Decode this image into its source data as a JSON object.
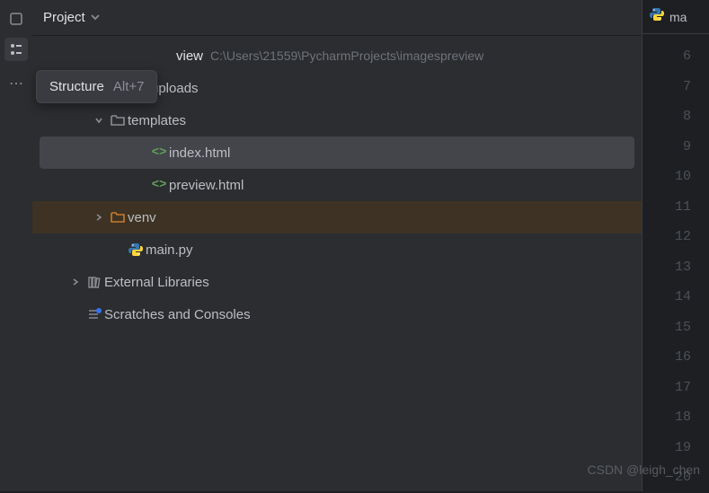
{
  "panel": {
    "title": "Project"
  },
  "tooltip": {
    "name": "Structure",
    "shortcut": "Alt+7"
  },
  "tree": {
    "root_label": "view",
    "root_path": "C:\\Users\\21559\\PycharmProjects\\imagespreview",
    "uploads": "uploads",
    "templates": "templates",
    "index_html": "index.html",
    "preview_html": "preview.html",
    "venv": "venv",
    "main_py": "main.py",
    "external_libs": "External Libraries",
    "scratches": "Scratches and Consoles"
  },
  "editor": {
    "tab_label": "ma",
    "line_start": 6,
    "line_end": 20
  },
  "watermark": "CSDN @leigh_chen"
}
